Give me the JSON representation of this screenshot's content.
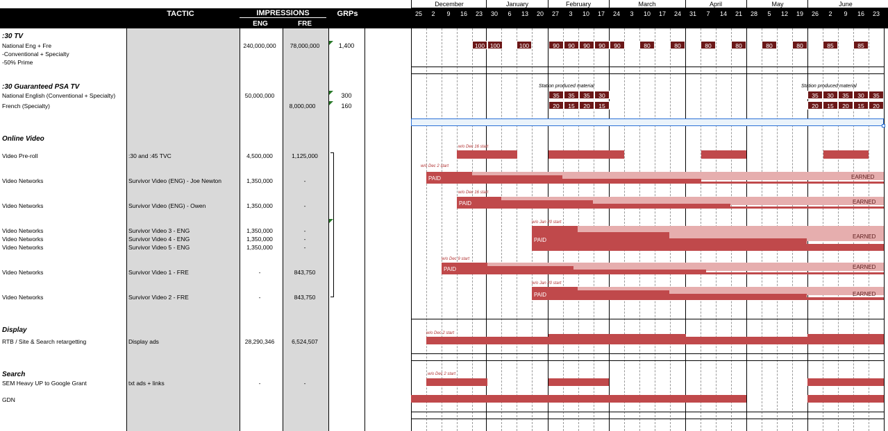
{
  "header": {
    "tactic": "TACTIC",
    "impressions": "IMPRESSIONS",
    "eng": "ENG",
    "fre": "FRE",
    "grps": "GRPs"
  },
  "months": [
    "December",
    "January",
    "February",
    "March",
    "April",
    "May",
    "June"
  ],
  "weeks": [
    "25",
    "2",
    "9",
    "16",
    "23",
    "30",
    "6",
    "13",
    "20",
    "27",
    "3",
    "10",
    "17",
    "24",
    "3",
    "10",
    "17",
    "24",
    "31",
    "7",
    "14",
    "21",
    "28",
    "5",
    "12",
    "19",
    "26",
    "2",
    "9",
    "16",
    "23"
  ],
  "sections": {
    "tv": {
      "title": ":30 TV",
      "line1": "National Eng + Fre",
      "line2": "-Conventional + Specialty",
      "line3": "-50% Prime",
      "eng": "240,000,000",
      "fre": "78,000,000",
      "grps": "1,400",
      "boxes": [
        "100",
        "100",
        "100",
        "90",
        "90",
        "90",
        "90",
        "90",
        "80",
        "80",
        "80",
        "80",
        "80",
        "80",
        "85",
        "85"
      ]
    },
    "psa": {
      "title": ":30 Guaranteed PSA TV",
      "line1": "National English (Conventional + Specialty)",
      "line2": "French (Specialty)",
      "eng": "50,000,000",
      "fre": "8,000,000",
      "grps1": "300",
      "grps2": "160",
      "station_note": "Station produced material",
      "row1_a": [
        "35",
        "35",
        "35",
        "30"
      ],
      "row2_a": [
        "20",
        "15",
        "20",
        "15"
      ],
      "row1_b": [
        "35",
        "30",
        "35",
        "30",
        "35"
      ],
      "row2_b": [
        "20",
        "15",
        "20",
        "15",
        "20"
      ]
    },
    "video": {
      "title": "Online Video",
      "rows": [
        {
          "tactic": "Video Pre-roll",
          "detail": ":30 and :45 TVC",
          "eng": "4,500,000",
          "fre": "1,125,000"
        },
        {
          "tactic": "Video Networks",
          "detail": "Survivor Video (ENG) - Joe Newton",
          "eng": "1,350,000",
          "fre": "-"
        },
        {
          "tactic": "Video Networks",
          "detail": "Survivor Video (ENG) - Owen",
          "eng": "1,350,000",
          "fre": "-"
        },
        {
          "tactic": "Video Networks",
          "detail": "Survivor Video 3 - ENG",
          "eng": "1,350,000",
          "fre": "-"
        },
        {
          "tactic": "Video Networks",
          "detail": "Survivor Video 4 - ENG",
          "eng": "1,350,000",
          "fre": "-"
        },
        {
          "tactic": "Video Networks",
          "detail": "Survivor Video 5 - ENG",
          "eng": "1,350,000",
          "fre": "-"
        },
        {
          "tactic": "Video Networks",
          "detail": "Survivor Video 1 - FRE",
          "eng": "-",
          "fre": "843,750"
        },
        {
          "tactic": "Video Networks",
          "detail": "Survivor Video 2 - FRE",
          "eng": "-",
          "fre": "843,750"
        }
      ],
      "notes": {
        "n1": "w/o Dec 16 start",
        "n2": "w/o Dec 2 start",
        "n3": "w/o Dec 16 start",
        "n4": "w/o Jan 20 start",
        "n5": "w/o Dec 9 start",
        "n6": "w/o Jan 20 start"
      },
      "paid": "PAID",
      "earned": "EARNED"
    },
    "display": {
      "title": "Display",
      "tactic": "RTB / Site & Search retargetting",
      "detail": "Display ads",
      "eng": "28,290,346",
      "fre": "6,524,507",
      "note": "w/o Dec 2 start"
    },
    "search": {
      "title": "Search",
      "tactic1": "SEM Heavy UP to Google Grant",
      "detail1": "txt ads + links",
      "eng1": "-",
      "fre1": "-",
      "tactic2": "GDN",
      "note": "w/o Dec 2 start"
    }
  },
  "colors": {
    "dark_box": "#6b1717",
    "paid_bar": "#c0494b",
    "earned_bar": "#e6aeae",
    "grey_col": "#d9d9d9",
    "selection": "#2a6fd6"
  }
}
